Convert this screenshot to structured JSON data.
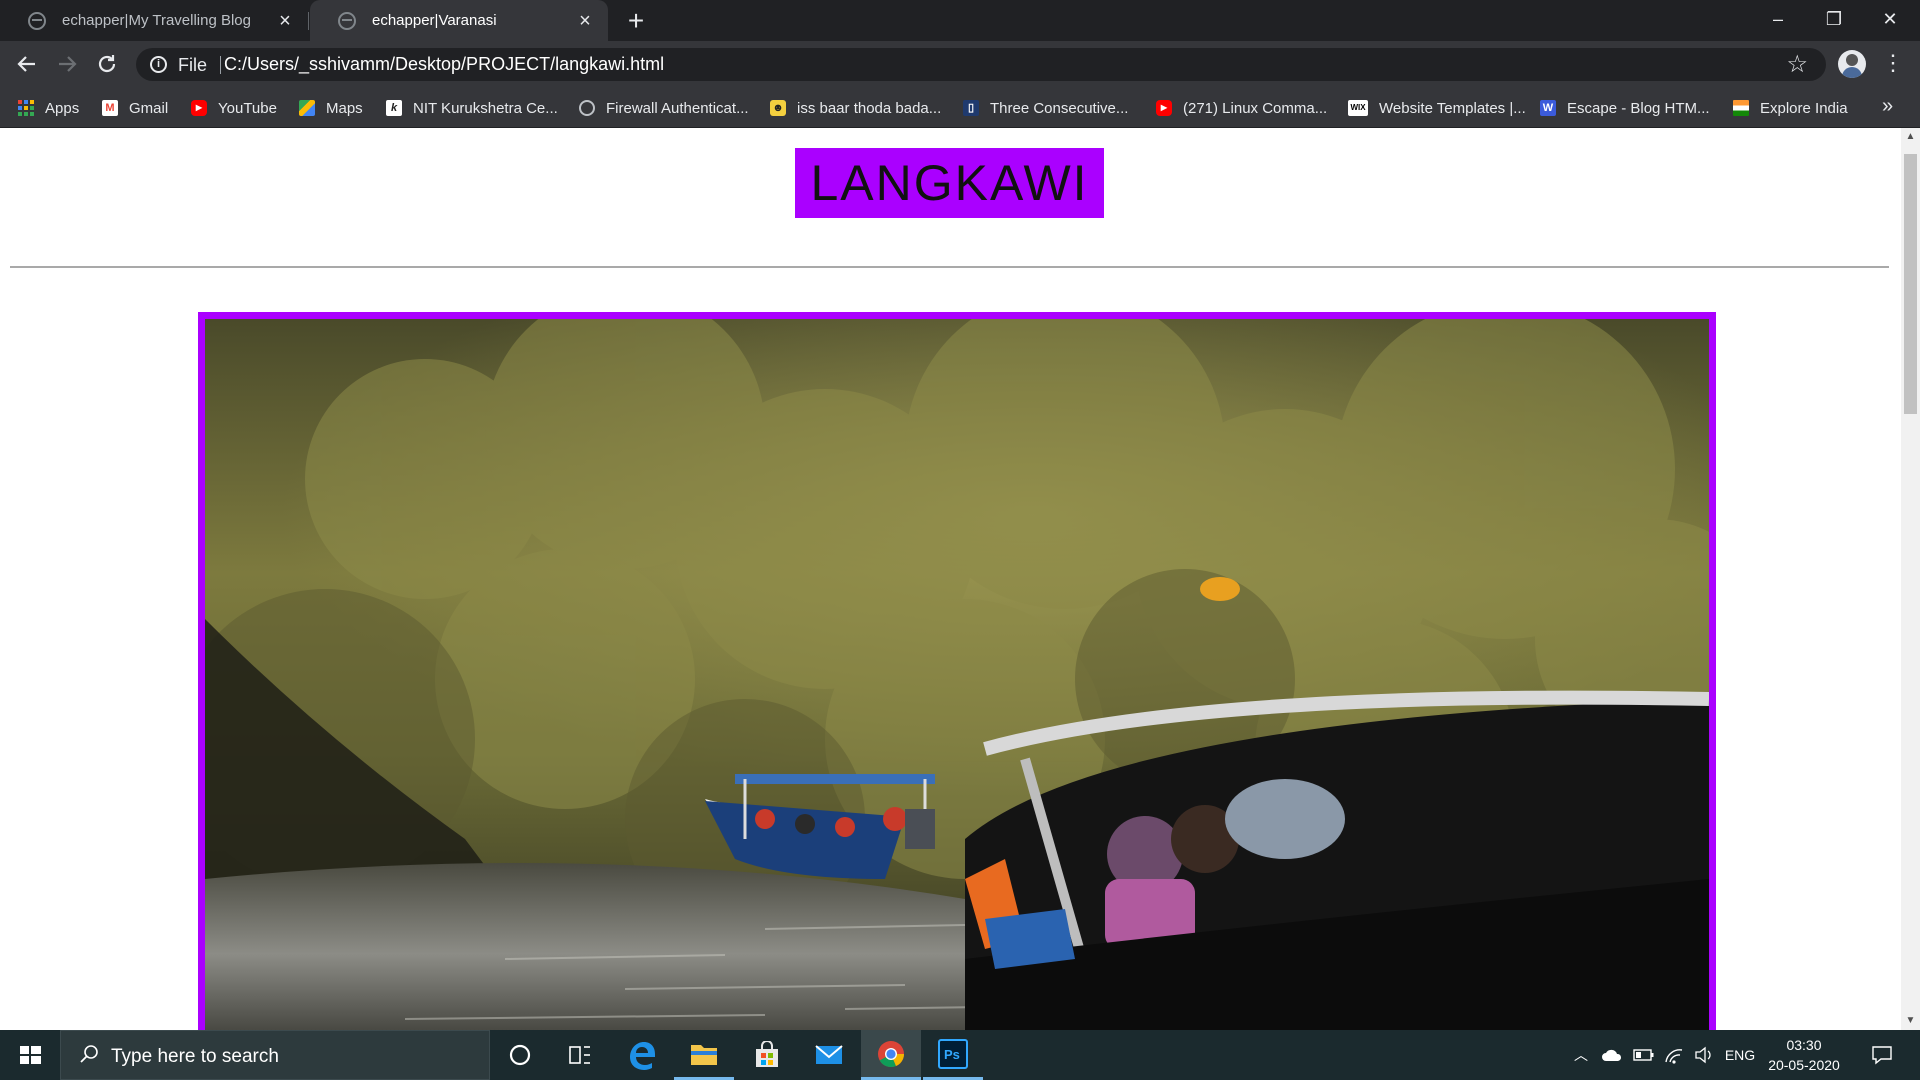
{
  "browser": {
    "tabs": [
      {
        "title": "echapper|My Travelling Blog",
        "active": false
      },
      {
        "title": "echapper|Varanasi",
        "active": true
      }
    ],
    "address": {
      "scheme_label": "File",
      "url": "C:/Users/_sshivamm/Desktop/PROJECT/langkawi.html"
    },
    "bookmarks": [
      {
        "label": "Apps",
        "icon": "apps-grid-icon"
      },
      {
        "label": "Gmail",
        "icon": "gmail-icon"
      },
      {
        "label": "YouTube",
        "icon": "youtube-icon"
      },
      {
        "label": "Maps",
        "icon": "maps-icon"
      },
      {
        "label": "NIT Kurukshetra Ce...",
        "icon": "nit-icon"
      },
      {
        "label": "Firewall Authenticat...",
        "icon": "globe-icon"
      },
      {
        "label": "iss baar thoda bada...",
        "icon": "smiley-icon"
      },
      {
        "label": "Three Consecutive...",
        "icon": "bookmark-icon"
      },
      {
        "label": "(271) Linux Comma...",
        "icon": "youtube-icon"
      },
      {
        "label": "Website Templates |...",
        "icon": "wix-icon"
      },
      {
        "label": "Escape - Blog HTM...",
        "icon": "w-icon"
      },
      {
        "label": "Explore India",
        "icon": "india-flag-icon"
      }
    ]
  },
  "page": {
    "title": "LANGKAWI",
    "accent_color": "#aa00ff"
  },
  "taskbar": {
    "search_placeholder": "Type here to search",
    "language": "ENG",
    "time": "03:30",
    "date": "20-05-2020"
  }
}
